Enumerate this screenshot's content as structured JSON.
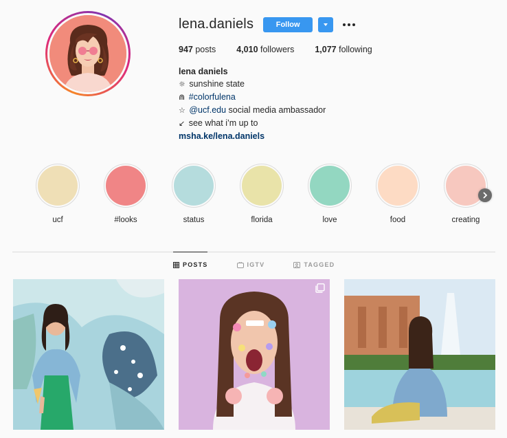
{
  "profile": {
    "username": "lena.daniels",
    "follow_label": "Follow",
    "posts_count": "947",
    "posts_label": "posts",
    "followers_count": "4,010",
    "followers_label": "followers",
    "following_count": "1,077",
    "following_label": "following",
    "bio": {
      "name": "lena daniels",
      "line1_glyph": "☼",
      "line1": "sunshine state",
      "line2_glyph": "⋒",
      "line2_hashtag": "#colorfulena",
      "line3_glyph": "☆",
      "line3_mention": "@ucf.edu",
      "line3_rest": "social media ambassador",
      "line4_glyph": "↙",
      "line4": "see what i’m up to",
      "website": "msha.ke/lena.daniels"
    }
  },
  "highlights": [
    {
      "label": "ucf",
      "color": "#efdfb6"
    },
    {
      "label": "#looks",
      "color": "#f08586"
    },
    {
      "label": "status",
      "color": "#b5dcdd"
    },
    {
      "label": "florida",
      "color": "#e9e3a9"
    },
    {
      "label": "love",
      "color": "#93d7c1"
    },
    {
      "label": "food",
      "color": "#fddbc4"
    },
    {
      "label": "creating",
      "color": "#f7c8bf"
    }
  ],
  "tabs": [
    {
      "label": "POSTS",
      "icon": "grid-icon",
      "active": true
    },
    {
      "label": "IGTV",
      "icon": "tv-icon",
      "active": false
    },
    {
      "label": "TAGGED",
      "icon": "tag-icon",
      "active": false
    }
  ],
  "colors": {
    "follow_blue": "#3897f0",
    "link_blue": "#003569",
    "text": "#262626",
    "muted": "#999999",
    "border": "#dbdbdb"
  },
  "posts": [
    {
      "name": "post-denim-jacket-ice-cream",
      "multi": false
    },
    {
      "name": "post-stickers-face-purple",
      "multi": true
    },
    {
      "name": "post-charge-on-fountain",
      "multi": false
    }
  ]
}
